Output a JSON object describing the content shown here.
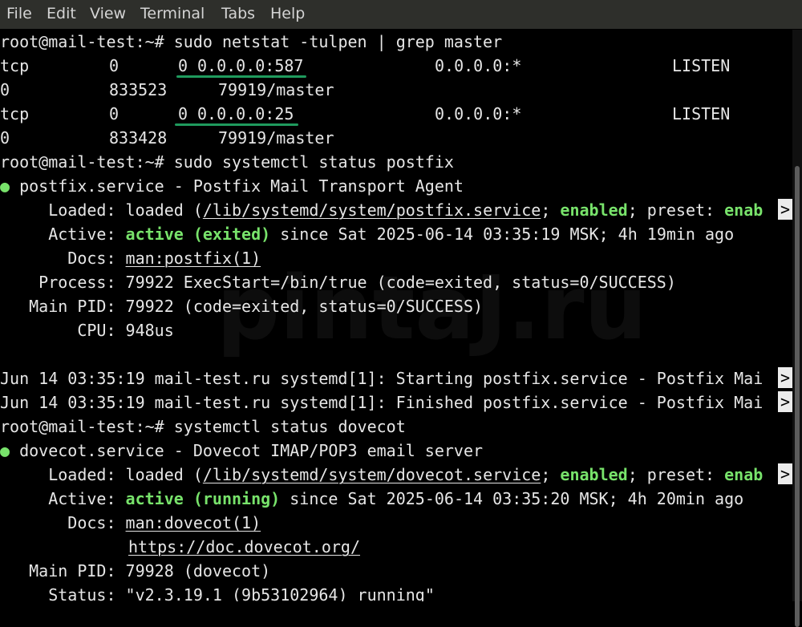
{
  "menubar": {
    "file": "File",
    "edit": "Edit",
    "view": "View",
    "terminal": "Terminal",
    "tabs": "Tabs",
    "help": "Help"
  },
  "watermark": "pintaJ.ru",
  "terminal": {
    "prompt1": "root@mail-test:~#",
    "cmd1": " sudo netstat -tulpen | grep master",
    "r1": {
      "proto": "tcp",
      "recvq": "0",
      "sendq": "0",
      "local": "0.0.0.0:587",
      "foreign": "0.0.0.0:*",
      "state": "LISTEN"
    },
    "r1b": {
      "user": "0",
      "inode": "833523",
      "pid": "79919/master"
    },
    "r2": {
      "proto": "tcp",
      "recvq": "0",
      "sendq": "0",
      "local": "0.0.0.0:25",
      "foreign": "0.0.0.0:*",
      "state": "LISTEN"
    },
    "r2b": {
      "user": "0",
      "inode": "833428",
      "pid": "79919/master"
    },
    "prompt2": "root@mail-test:~#",
    "cmd2": " sudo systemctl status postfix",
    "postfix": {
      "bullet": "●",
      "title": " postfix.service - Postfix Mail Transport Agent",
      "loaded_label": "     Loaded:",
      "loaded_pre": " loaded (",
      "loaded_path": "/lib/systemd/system/postfix.service",
      "loaded_mid": "; ",
      "enabled": "enabled",
      "preset": "; preset: ",
      "enab": "enab",
      "active_label": "     Active:",
      "active_state": "active (exited)",
      "active_rest": " since Sat 2025-06-14 03:35:19 MSK; 4h 19min ago",
      "docs_label": "       Docs:",
      "docs": "man:postfix(1)",
      "process_label": "    Process:",
      "process": " 79922 ExecStart=/bin/true (code=exited, status=0/SUCCESS)",
      "mainpid_label": "   Main PID:",
      "mainpid": " 79922 (code=exited, status=0/SUCCESS)",
      "cpu_label": "        CPU:",
      "cpu": " 948us"
    },
    "log1": "Jun 14 03:35:19 mail-test.ru systemd[1]: Starting postfix.service - Postfix Mai",
    "log2": "Jun 14 03:35:19 mail-test.ru systemd[1]: Finished postfix.service - Postfix Mai",
    "clip_mark": ">",
    "prompt3": "root@mail-test:~#",
    "cmd3": " systemctl status dovecot",
    "dovecot": {
      "bullet": "●",
      "title": " dovecot.service - Dovecot IMAP/POP3 email server",
      "loaded_label": "     Loaded:",
      "loaded_pre": " loaded (",
      "loaded_path": "/lib/systemd/system/dovecot.service",
      "loaded_mid": "; ",
      "enabled": "enabled",
      "preset": "; preset: ",
      "enab": "enab",
      "active_label": "     Active:",
      "active_state": "active (running)",
      "active_rest": " since Sat 2025-06-14 03:35:20 MSK; 4h 20min ago",
      "docs_label": "       Docs:",
      "docs1": "man:dovecot(1)",
      "docs2": "https://doc.dovecot.org/",
      "mainpid_label": "   Main PID:",
      "mainpid": " 79928 (dovecot)",
      "status_label": "     Status:",
      "status": " \"v2.3.19.1 (9b53102964) running\""
    }
  },
  "colors": {
    "green": "#78e36b",
    "annotation": "#1f9a5d"
  }
}
